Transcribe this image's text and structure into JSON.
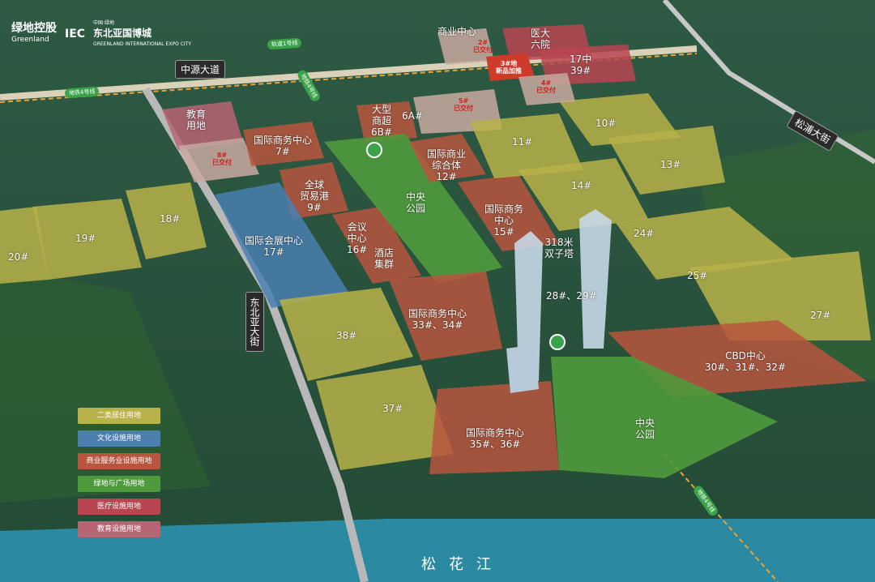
{
  "brand": {
    "cn": "绿地控股",
    "en": "Greenland",
    "iec": "IEC",
    "expo_cn": "东北亚国博城",
    "expo_prefix": "中国·绿地",
    "expo_en": "GREENLAND INTERNATIONAL EXPO CITY"
  },
  "roads": {
    "zhongyuan": "中源大道",
    "songpu": "松浦大街",
    "dongbeiya": "东北亚大街",
    "metro4_west": "地铁4号线",
    "metro1": "轨道1号线",
    "metro4_mid": "地铁4号线",
    "metro4_south": "地铁4号线"
  },
  "plots": {
    "p2": "2#\n已交付",
    "p3": "3#地\n新品加推",
    "p4": "4#\n已交付",
    "p5": "5#\n已交付",
    "p8": "8#\n已交付",
    "commercial": "商业中心",
    "hospital": "医大\n六院",
    "p17z": "17中\n39#",
    "p6a": "6A#",
    "p6b": "大型\n商超\n6B#",
    "edu": "教育\n用地",
    "p7": "国际商务中心\n7#",
    "p9": "全球\n贸易港\n9#",
    "p10": "10#",
    "p11": "11#",
    "p12": "国际商业\n综合体\n12#",
    "p13": "13#",
    "p14": "14#",
    "p15": "国际商务\n中心\n15#",
    "p16": "会议\n中心\n16#",
    "hotel": "酒店\n集群",
    "p17": "国际会展中心\n17#",
    "p18": "18#",
    "p19": "19#",
    "p20": "20#",
    "park1": "中央\n公园",
    "twin": "318米\n双子塔",
    "p2829": "28#、29#",
    "p24": "24#",
    "p25": "25#",
    "p27": "27#",
    "p3334": "国际商务中心\n33#、34#",
    "p38": "38#",
    "p37": "37#",
    "cbd": "CBD中心\n30#、31#、32#",
    "p3536": "国际商务中心\n35#、36#",
    "park2": "中央\n公园"
  },
  "legend": [
    {
      "label": "二类居住用地",
      "color": "#b9b24a"
    },
    {
      "label": "文化设施用地",
      "color": "#4a7fb0"
    },
    {
      "label": "商业服务业设施用地",
      "color": "#b8553e"
    },
    {
      "label": "绿地与广场用地",
      "color": "#4f9a3c"
    },
    {
      "label": "医疗设施用地",
      "color": "#b84550"
    },
    {
      "label": "教育设施用地",
      "color": "#b86473"
    }
  ],
  "river": "松花江",
  "icons": {
    "station1": "metro-station-icon",
    "station2": "metro-station-icon"
  }
}
